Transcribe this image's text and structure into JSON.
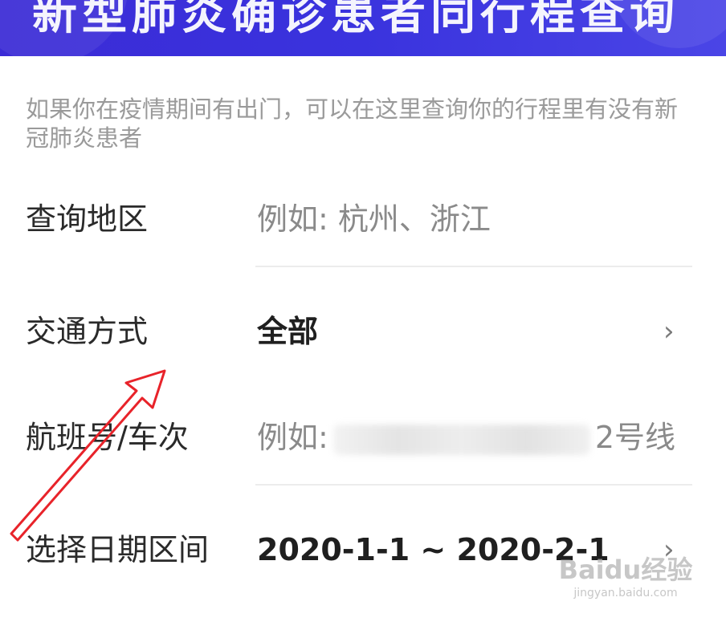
{
  "banner": {
    "title": "新型肺炎确诊患者同行程查询"
  },
  "description": "如果你在疫情期间有出门，可以在这里查询你的行程里有没有新冠肺炎患者",
  "form": {
    "region": {
      "label": "查询地区",
      "placeholder": "例如: 杭州、浙江"
    },
    "transport": {
      "label": "交通方式",
      "value": "全部"
    },
    "flight": {
      "label": "航班号/车次",
      "prefix": "例如:",
      "suffix": "2号线"
    },
    "date": {
      "label": "选择日期区间",
      "value": "2020-1-1 ~ 2020-2-1"
    }
  },
  "watermark": {
    "logo": "Baidu经验",
    "url": "jingyan.baidu.com"
  },
  "colors": {
    "banner": "#3b2bd6",
    "annotation_arrow": "#e8232a",
    "placeholder": "#8a8a8a"
  }
}
